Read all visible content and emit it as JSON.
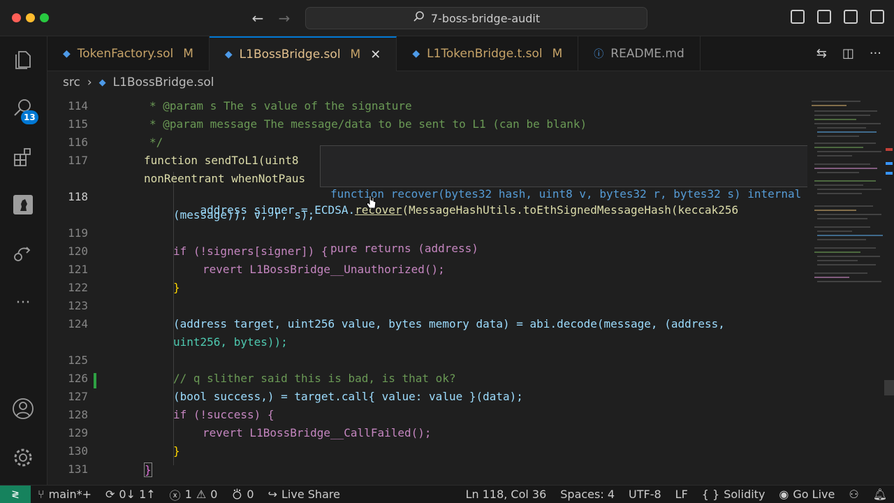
{
  "window": {
    "title": "7-boss-bridge-audit"
  },
  "activity_bar": {
    "search_badge": "13"
  },
  "tabs": [
    {
      "label": "TokenFactory.sol",
      "modified": "M"
    },
    {
      "label": "L1BossBridge.sol",
      "modified": "M",
      "close": "✕"
    },
    {
      "label": "L1TokenBridge.t.sol",
      "modified": "M"
    },
    {
      "label": "README.md",
      "modified": ""
    }
  ],
  "breadcrumb": {
    "folder": "src",
    "file": "L1BossBridge.sol"
  },
  "editor": {
    "line_numbers": [
      "114",
      "115",
      "116",
      "117",
      "",
      "118",
      "",
      "119",
      "120",
      "121",
      "122",
      "123",
      "124",
      "",
      "125",
      "126",
      "127",
      "128",
      "129",
      "130",
      "131"
    ],
    "lines": {
      "l114": "* @param s The s value of the signature",
      "l115": "* @param message The message/data to be sent to L1 (can be blank)",
      "l116": "*/",
      "l117a": "function sendToL1(uint8",
      "l117b": "nonReentrant whenNotPaus",
      "l118a_pre": "address signer = ECDSA.",
      "l118a_fn": "recover",
      "l118a_post": "(MessageHashUtils.toEthSignedMessageHash(keccak256",
      "l118b": "(message)), v, r, s);",
      "l120": "if (!signers[signer]) {",
      "l121": "revert L1BossBridge__Unauthorized();",
      "l122": "}",
      "l124a": "(address target, uint256 value, bytes memory data) = abi.decode(message, (address,",
      "l124b": "uint256, bytes));",
      "l126": "// q slither said this is bad, is that ok?",
      "l127": "(bool success,) = target.call{ value: value }(data);",
      "l128": "if (!success) {",
      "l129": "revert L1BossBridge__CallFailed();",
      "l130": "}",
      "l131": "}"
    }
  },
  "hover": {
    "line1": "function recover(bytes32 hash, uint8 v, bytes32 r, bytes32 s) internal",
    "line2": "pure returns (address)"
  },
  "status_bar": {
    "branch": "main*+",
    "sync": "0↓ 1↑",
    "errors": "1",
    "warnings": "0",
    "ports": "0",
    "live_share": "Live Share",
    "position": "Ln 118, Col 36",
    "spaces": "Spaces: 4",
    "encoding": "UTF-8",
    "eol": "LF",
    "language": "Solidity",
    "go_live": "Go Live"
  }
}
